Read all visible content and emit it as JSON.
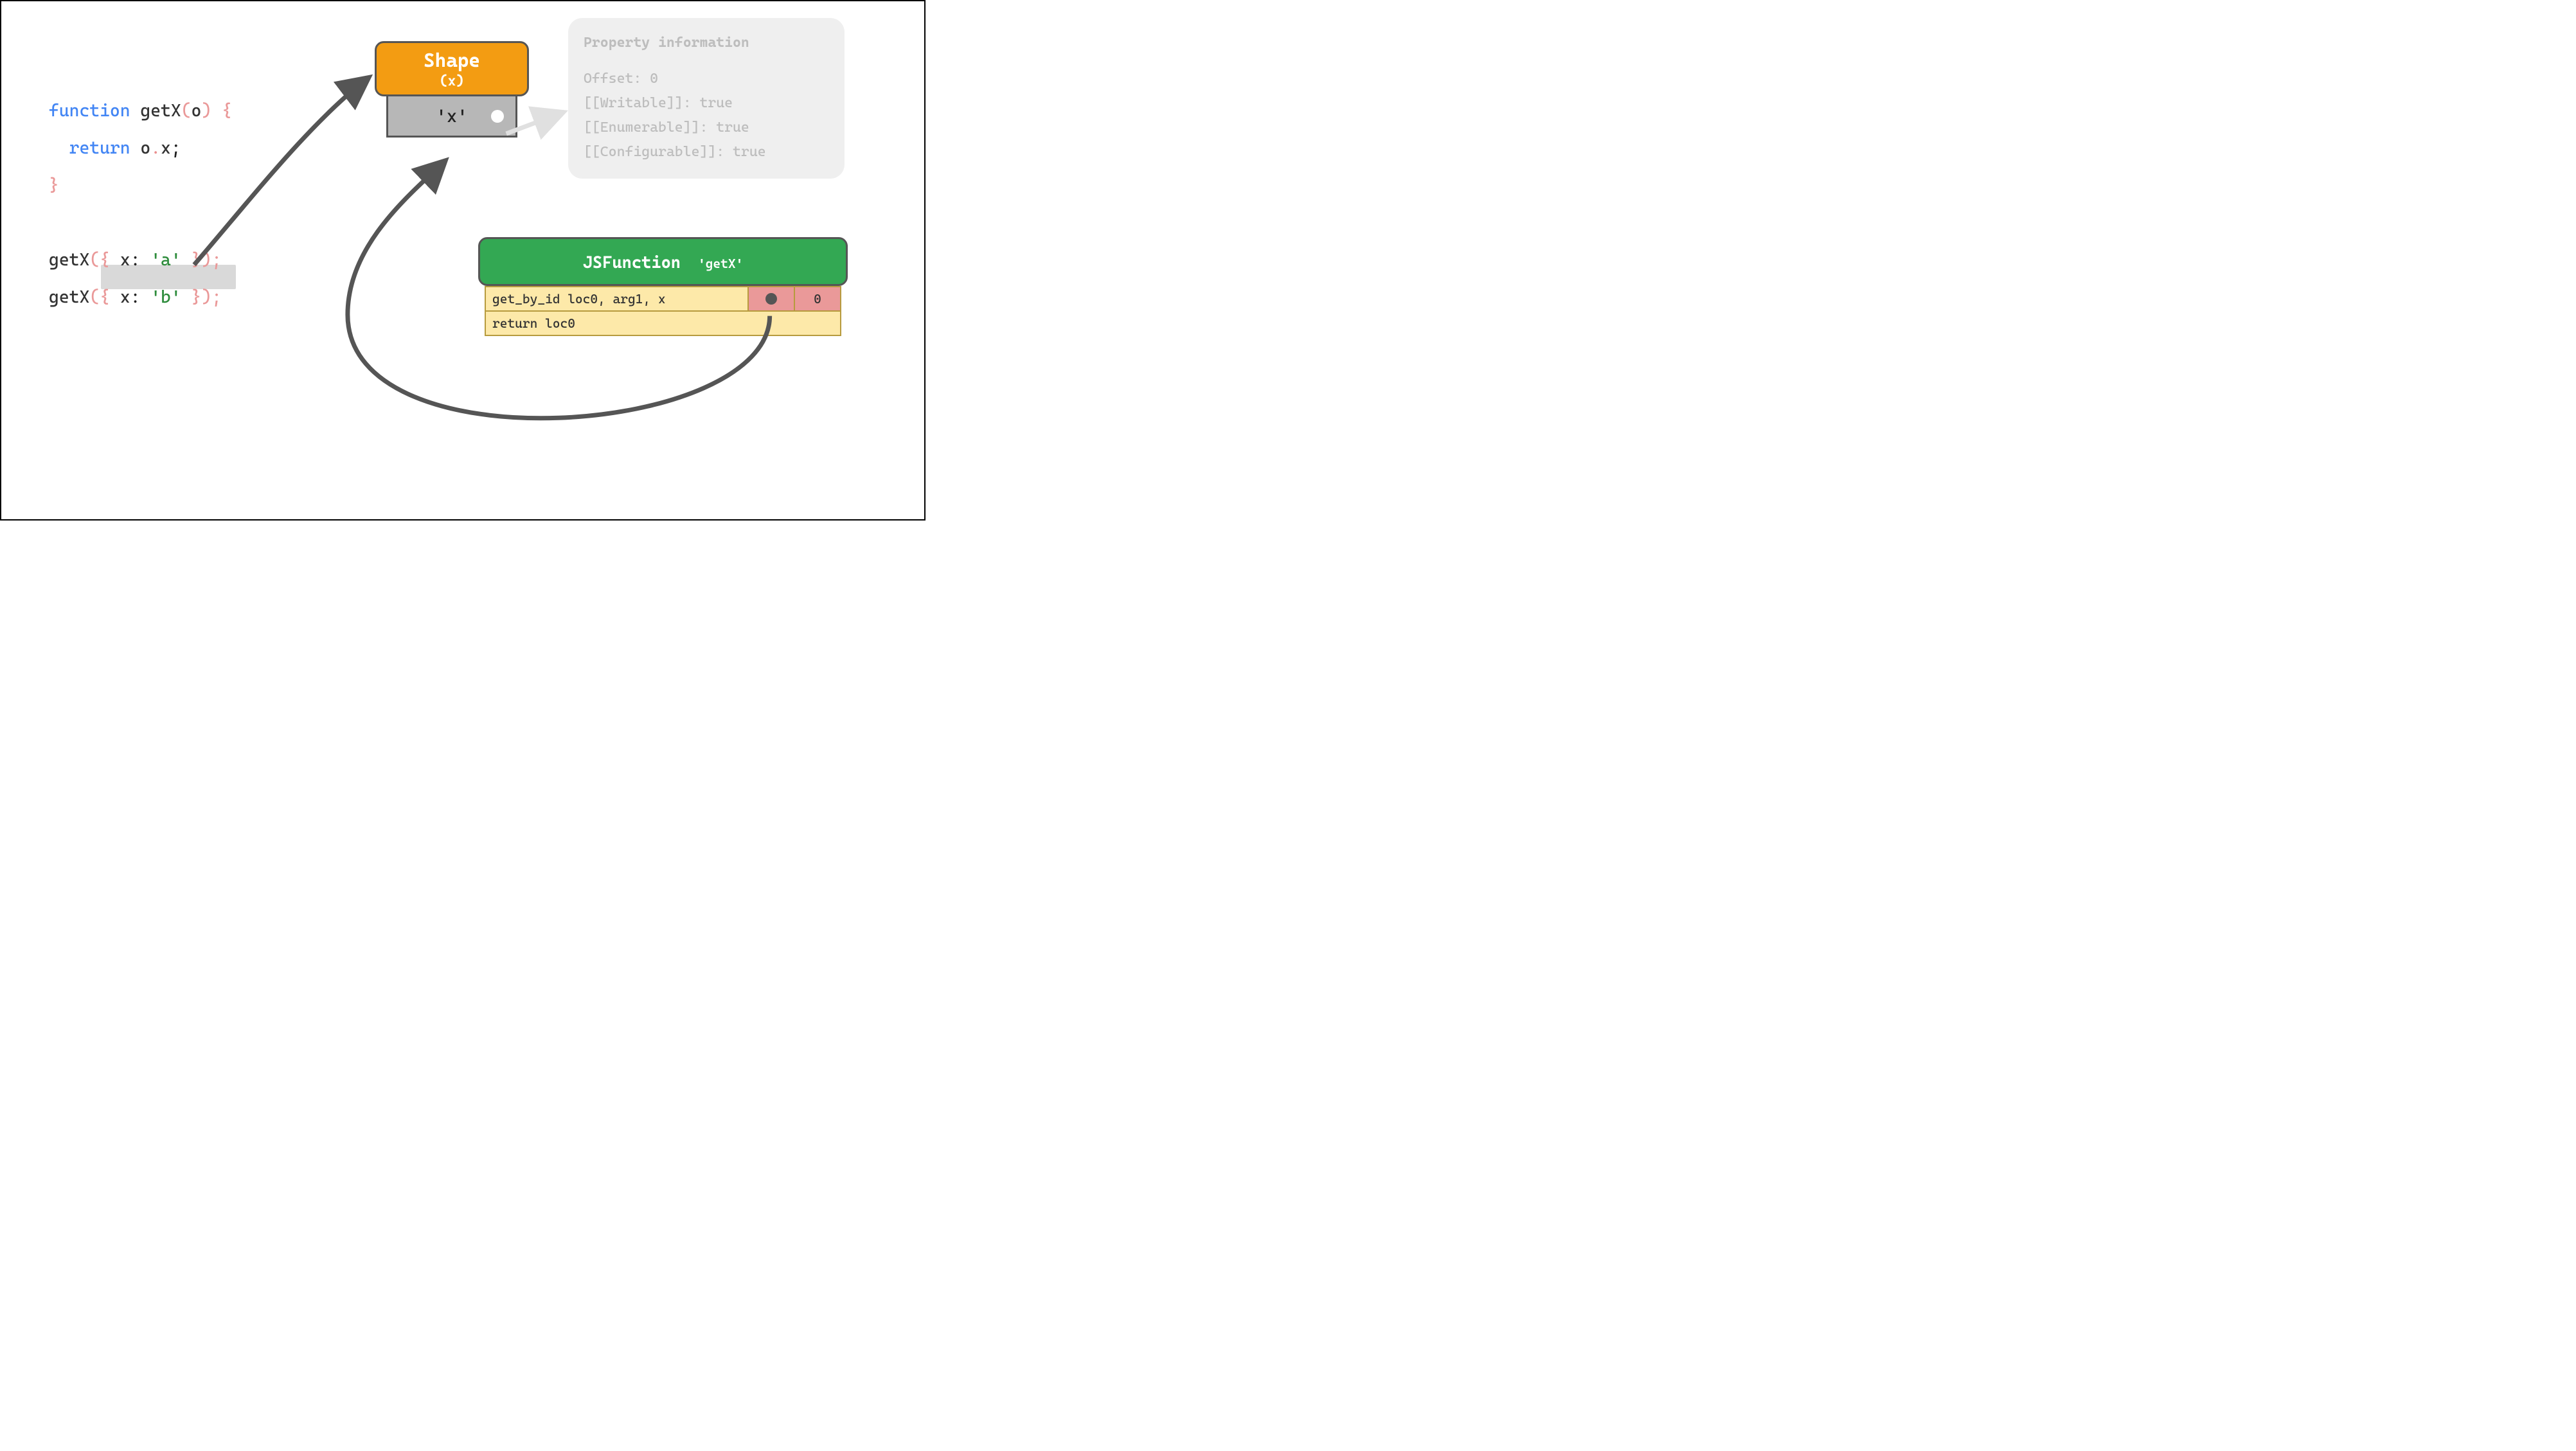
{
  "code": {
    "line1": {
      "kw": "function",
      "name": "getX",
      "paren_open": "(",
      "param": "o",
      "paren_close": ")",
      "brace_open": " {"
    },
    "line2": {
      "kw": "return",
      "obj": "o",
      "dot": ".",
      "prop": "x",
      "semi": ";"
    },
    "line3": {
      "brace_close": "}"
    },
    "call1": {
      "fn": "getX",
      "args_open": "({ ",
      "key": "x",
      "colon": ":",
      "val": "'a'",
      "args_close": " });"
    },
    "call2": {
      "fn": "getX",
      "args_open": "({ ",
      "key": "x",
      "colon": ":",
      "val": "'b'",
      "args_close": " });"
    }
  },
  "shape": {
    "title": "Shape",
    "subtitle": "(x)",
    "row": "'x'"
  },
  "property_info": {
    "title": "Property information",
    "lines": [
      "Offset: 0",
      "[[Writable]]: true",
      "[[Enumerable]]: true",
      "[[Configurable]]: true"
    ]
  },
  "jsfunction": {
    "title": "JSFunction",
    "name": "'getX'",
    "rows": [
      {
        "bytecode": "get_by_id loc0, arg1, x",
        "cache_slot": true,
        "cache_value": "0"
      },
      {
        "bytecode": "return loc0"
      }
    ]
  }
}
